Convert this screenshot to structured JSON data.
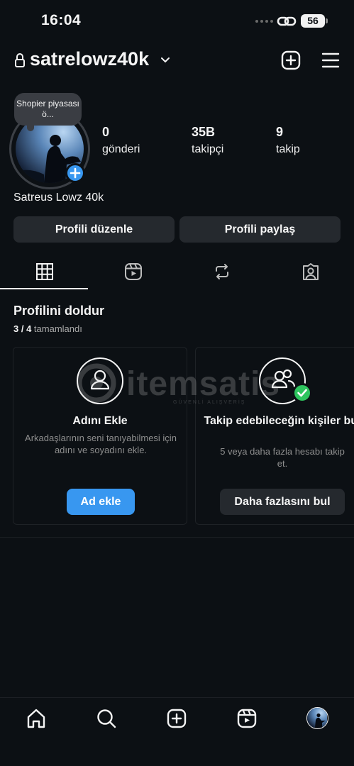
{
  "status_bar": {
    "time": "16:04",
    "battery": "56"
  },
  "header": {
    "username": "satrelowz40k"
  },
  "profile": {
    "note": "Shopier piyasası ö...",
    "display_name": "Satreus Lowz 40k",
    "stats": [
      {
        "value": "0",
        "label": "gönderi"
      },
      {
        "value": "35B",
        "label": "takipçi"
      },
      {
        "value": "9",
        "label": "takip"
      }
    ],
    "buttons": {
      "edit": "Profili düzenle",
      "share": "Profili paylaş"
    }
  },
  "tabs": [
    "grid-icon",
    "reels-icon",
    "reposts-icon",
    "tagged-icon"
  ],
  "completion": {
    "title": "Profilini doldur",
    "progress": "3 / 4",
    "progress_label": "tamamlandı",
    "cards": [
      {
        "title": "Adını Ekle",
        "description": "Arkadaşlarının seni tanıyabilmesi için adını ve soyadını ekle.",
        "button": "Ad ekle",
        "icon": "person-icon",
        "completed": false
      },
      {
        "title": "Takip edebileceğin kişiler bul",
        "description": "5 veya daha fazla hesabı takip et.",
        "button": "Daha fazlasını bul",
        "icon": "people-icon",
        "completed": true
      }
    ]
  },
  "watermark": {
    "text": "itemsatis",
    "sub": "GÜVENLİ ALIŞVERİŞ"
  },
  "bottom_nav": [
    "home-icon",
    "search-icon",
    "create-icon",
    "reels-icon",
    "profile-avatar"
  ],
  "colors": {
    "background": "#0c1014",
    "button": "#25292e",
    "accent": "#3897f0",
    "success": "#2ec55e"
  }
}
